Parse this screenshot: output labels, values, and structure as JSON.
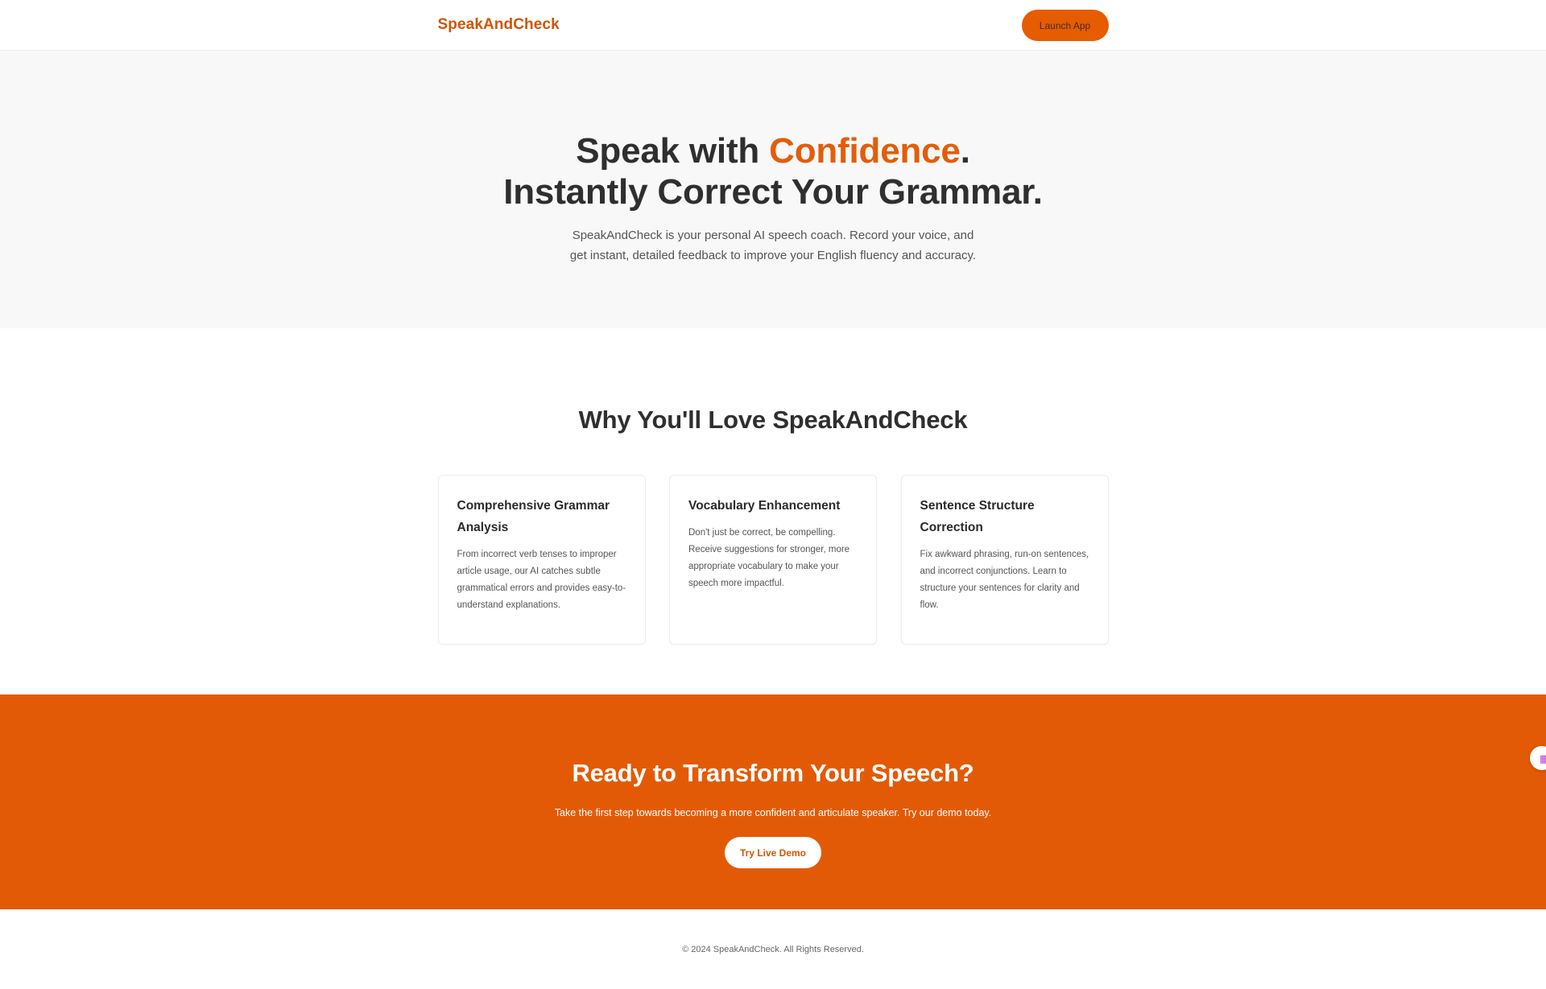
{
  "header": {
    "logo": "SpeakAndCheck",
    "launch_label": "Launch App"
  },
  "hero": {
    "title_part1": "Speak with ",
    "title_accent": "Confidence",
    "title_part2": ".",
    "title_line2": "Instantly Correct Your Grammar.",
    "subtitle": "SpeakAndCheck is your personal AI speech coach. Record your voice, and get instant, detailed feedback to improve your English fluency and accuracy."
  },
  "features": {
    "heading": "Why You'll Love SpeakAndCheck",
    "cards": [
      {
        "title": "Comprehensive Grammar Analysis",
        "text": "From incorrect verb tenses to improper article usage, our AI catches subtle grammatical errors and provides easy-to-understand explanations."
      },
      {
        "title": "Vocabulary Enhancement",
        "text": "Don't just be correct, be compelling. Receive suggestions for stronger, more appropriate vocabulary to make your speech more impactful."
      },
      {
        "title": "Sentence Structure Correction",
        "text": "Fix awkward phrasing, run-on sentences, and incorrect conjunctions. Learn to structure your sentences for clarity and flow."
      }
    ]
  },
  "cta": {
    "heading": "Ready to Transform Your Speech?",
    "text": "Take the first step towards becoming a more confident and articulate speaker. Try our demo today.",
    "button_label": "Try Live Demo",
    "widget_icon": "grid-icon"
  },
  "footer": {
    "copyright": "© 2024 SpeakAndCheck. All Rights Reserved."
  },
  "colors": {
    "accent": "#e35d0a",
    "cta_background": "#e35a06",
    "hero_background": "#f8f8f8"
  }
}
